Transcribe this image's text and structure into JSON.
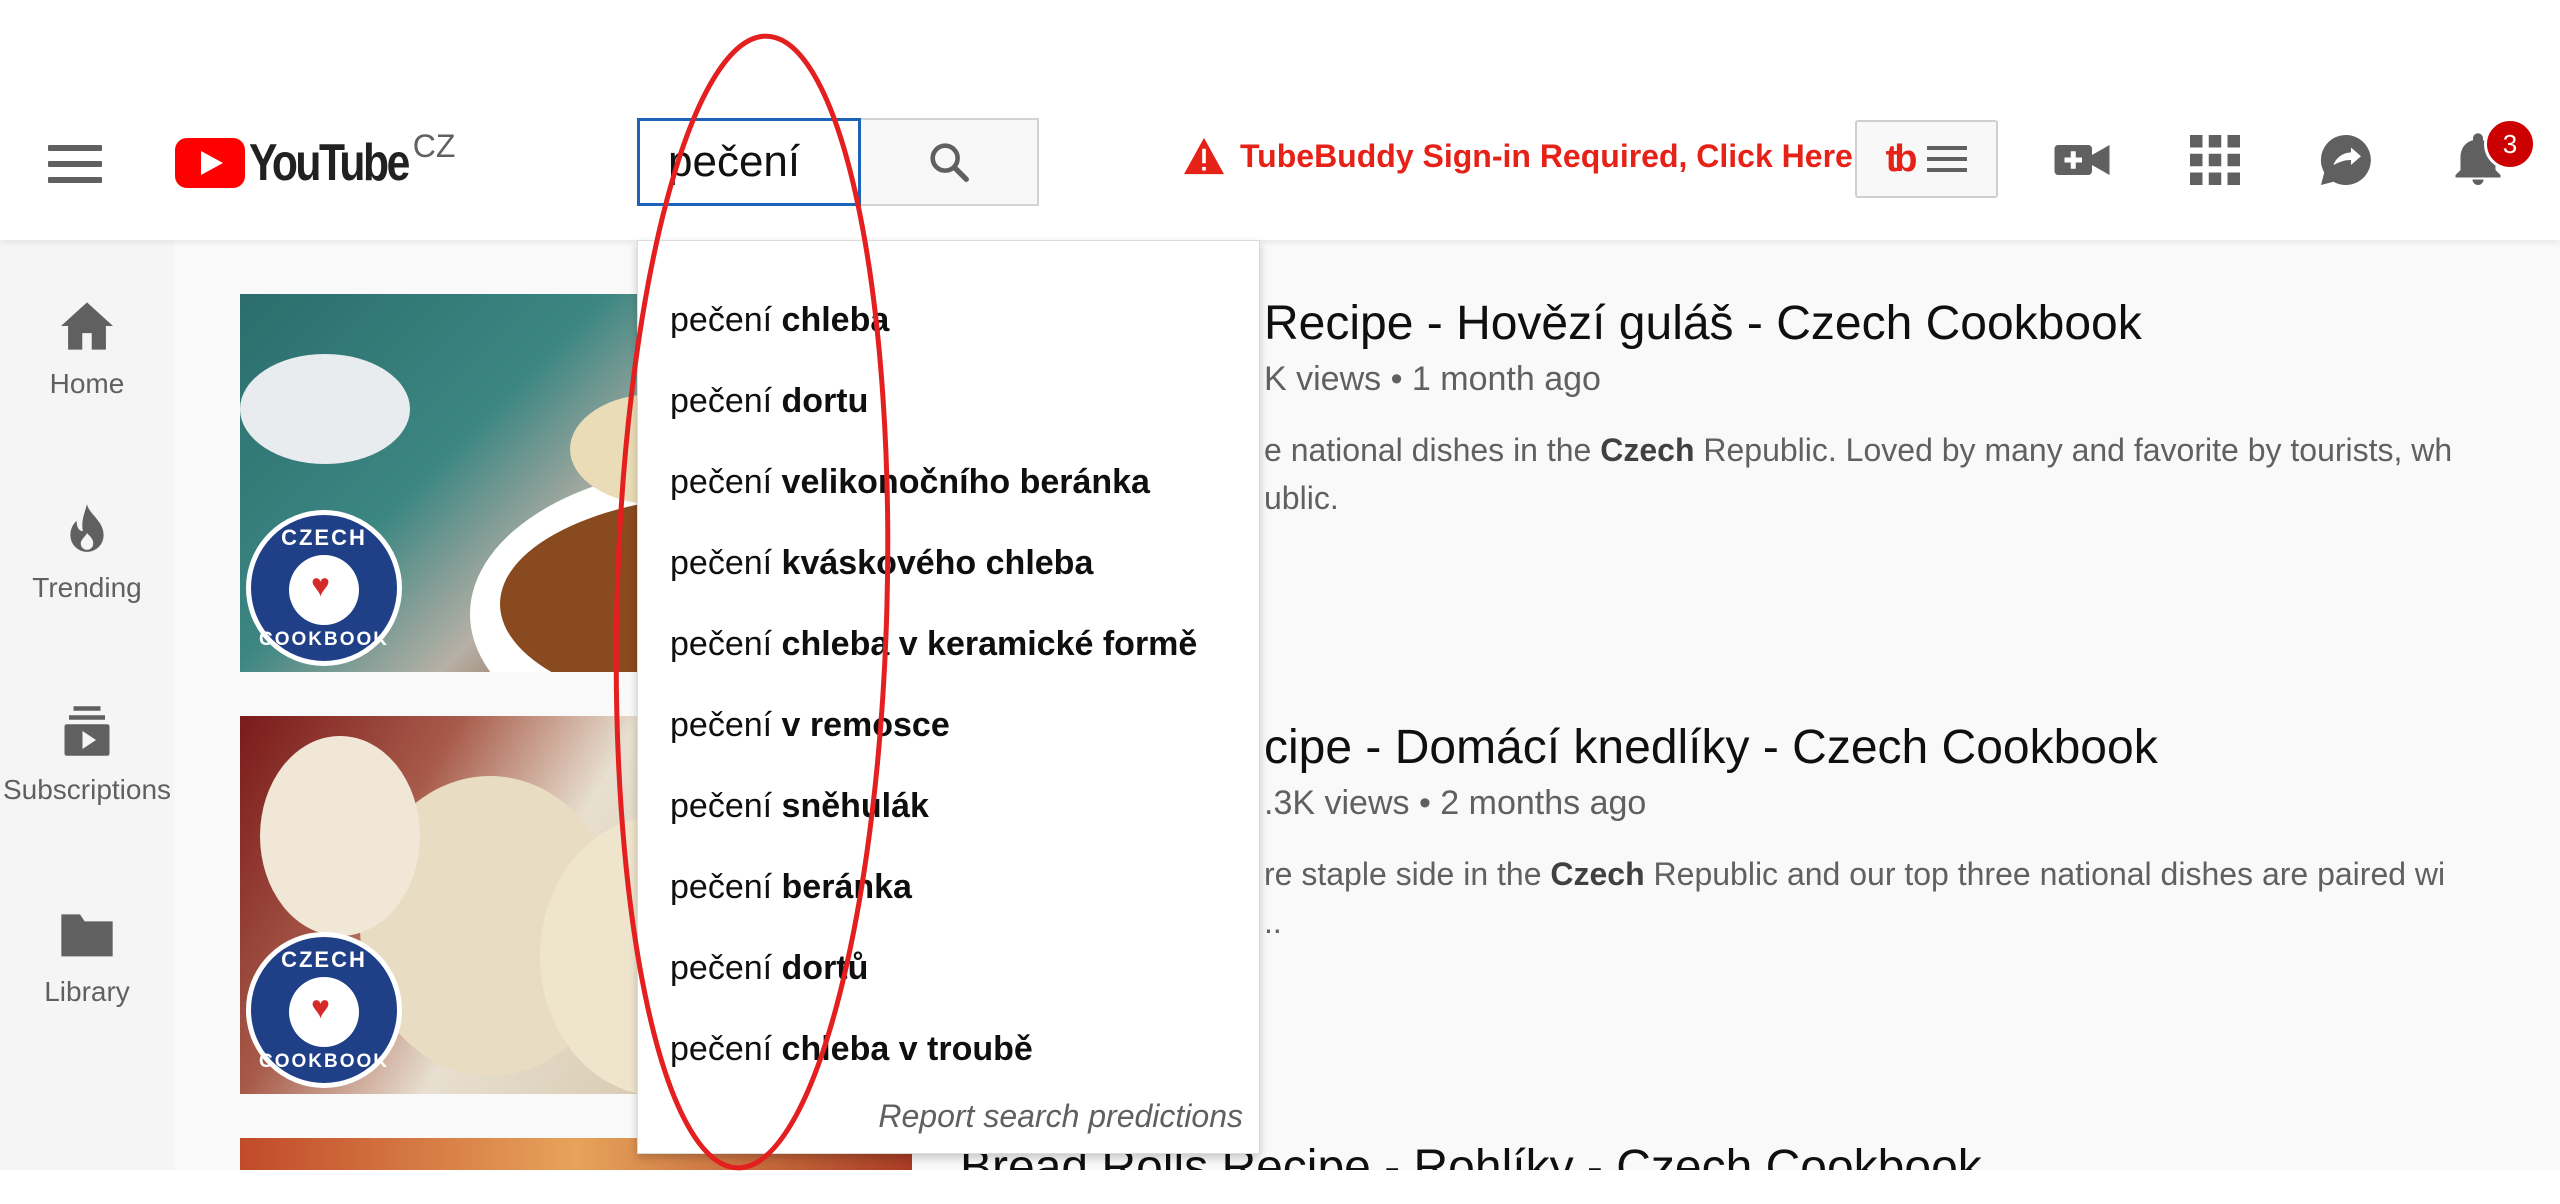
{
  "header": {
    "logo_text": "YouTube",
    "region": "CZ",
    "search_value": "pečení",
    "tubebuddy_warning": "TubeBuddy Sign-in Required, Click Here",
    "tubebuddy_logo": "tb",
    "notification_count": "3"
  },
  "sidebar": {
    "items": [
      {
        "label": "Home",
        "icon": "home-icon"
      },
      {
        "label": "Trending",
        "icon": "flame-icon"
      },
      {
        "label": "Subscriptions",
        "icon": "subscriptions-icon"
      },
      {
        "label": "Library",
        "icon": "folder-icon"
      }
    ]
  },
  "dropdown": {
    "prefix": "pečení ",
    "suggestions": [
      "chleba",
      "dortu",
      "velikonočního beránka",
      "kváskového chleba",
      "chleba v keramické formě",
      "v remosce",
      "sněhulák",
      "beránka",
      "dortů",
      "chleba v troubě"
    ],
    "report": "Report search predictions"
  },
  "videos": [
    {
      "title": "Recipe - Hovězí guláš - Czech Cookbook",
      "meta": "K views • 1 month ago",
      "desc_line1_pre": "e national dishes in the ",
      "desc_bold": "Czech",
      "desc_line1_post": " Republic. Loved by many and favorite by tourists, wh",
      "desc_line2": "ublic."
    },
    {
      "title": "cipe - Domácí knedlíky - Czech Cookbook",
      "meta": ".3K views • 2 months ago",
      "desc_line1_pre": "re staple side in the ",
      "desc_bold": "Czech",
      "desc_line1_post": " Republic and our top three national dishes are paired wi",
      "desc_line2": ".."
    },
    {
      "title": "Bread Rolls Recipe - Rohlíky - Czech Cookbook"
    }
  ],
  "thumb_badge": {
    "top": "CZECH",
    "bottom": "COOKBOOK"
  },
  "colors": {
    "accent_red": "#ff0000",
    "annotation_red": "#e41f1f",
    "search_border": "#1c62b9"
  }
}
